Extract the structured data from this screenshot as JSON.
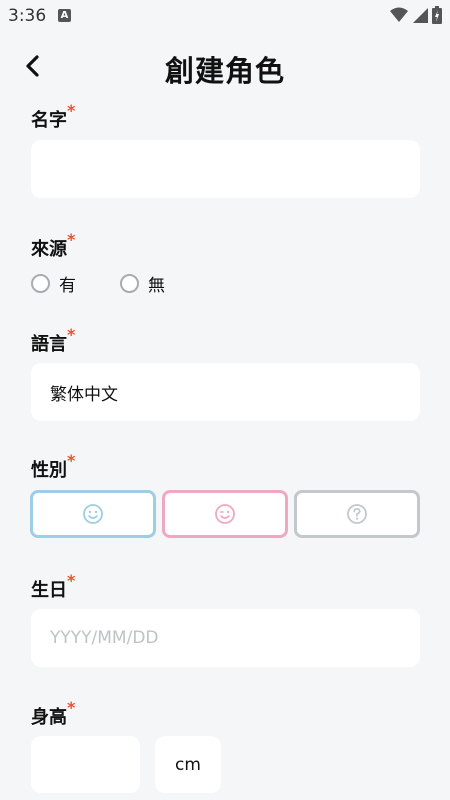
{
  "status_bar": {
    "time": "3:36",
    "notification_glyph": "A"
  },
  "header": {
    "title": "創建角色",
    "back_icon": "chevron-left-icon"
  },
  "form": {
    "name": {
      "label": "名字",
      "required_mark": "*",
      "value": ""
    },
    "origin": {
      "label": "來源",
      "required_mark": "*",
      "options": [
        {
          "label": "有",
          "selected": false
        },
        {
          "label": "無",
          "selected": false
        }
      ]
    },
    "language": {
      "label": "語言",
      "required_mark": "*",
      "value": "繁体中文"
    },
    "gender": {
      "label": "性別",
      "required_mark": "*",
      "options": [
        {
          "icon": "smile-icon",
          "color": "#9ecde6"
        },
        {
          "icon": "wink-icon",
          "color": "#f0a8c2"
        },
        {
          "icon": "question-icon",
          "color": "#c4c7cb"
        }
      ]
    },
    "birthday": {
      "label": "生日",
      "required_mark": "*",
      "placeholder": "YYYY/MM/DD"
    },
    "height": {
      "label": "身高",
      "required_mark": "*",
      "value": "",
      "unit": "cm"
    }
  }
}
